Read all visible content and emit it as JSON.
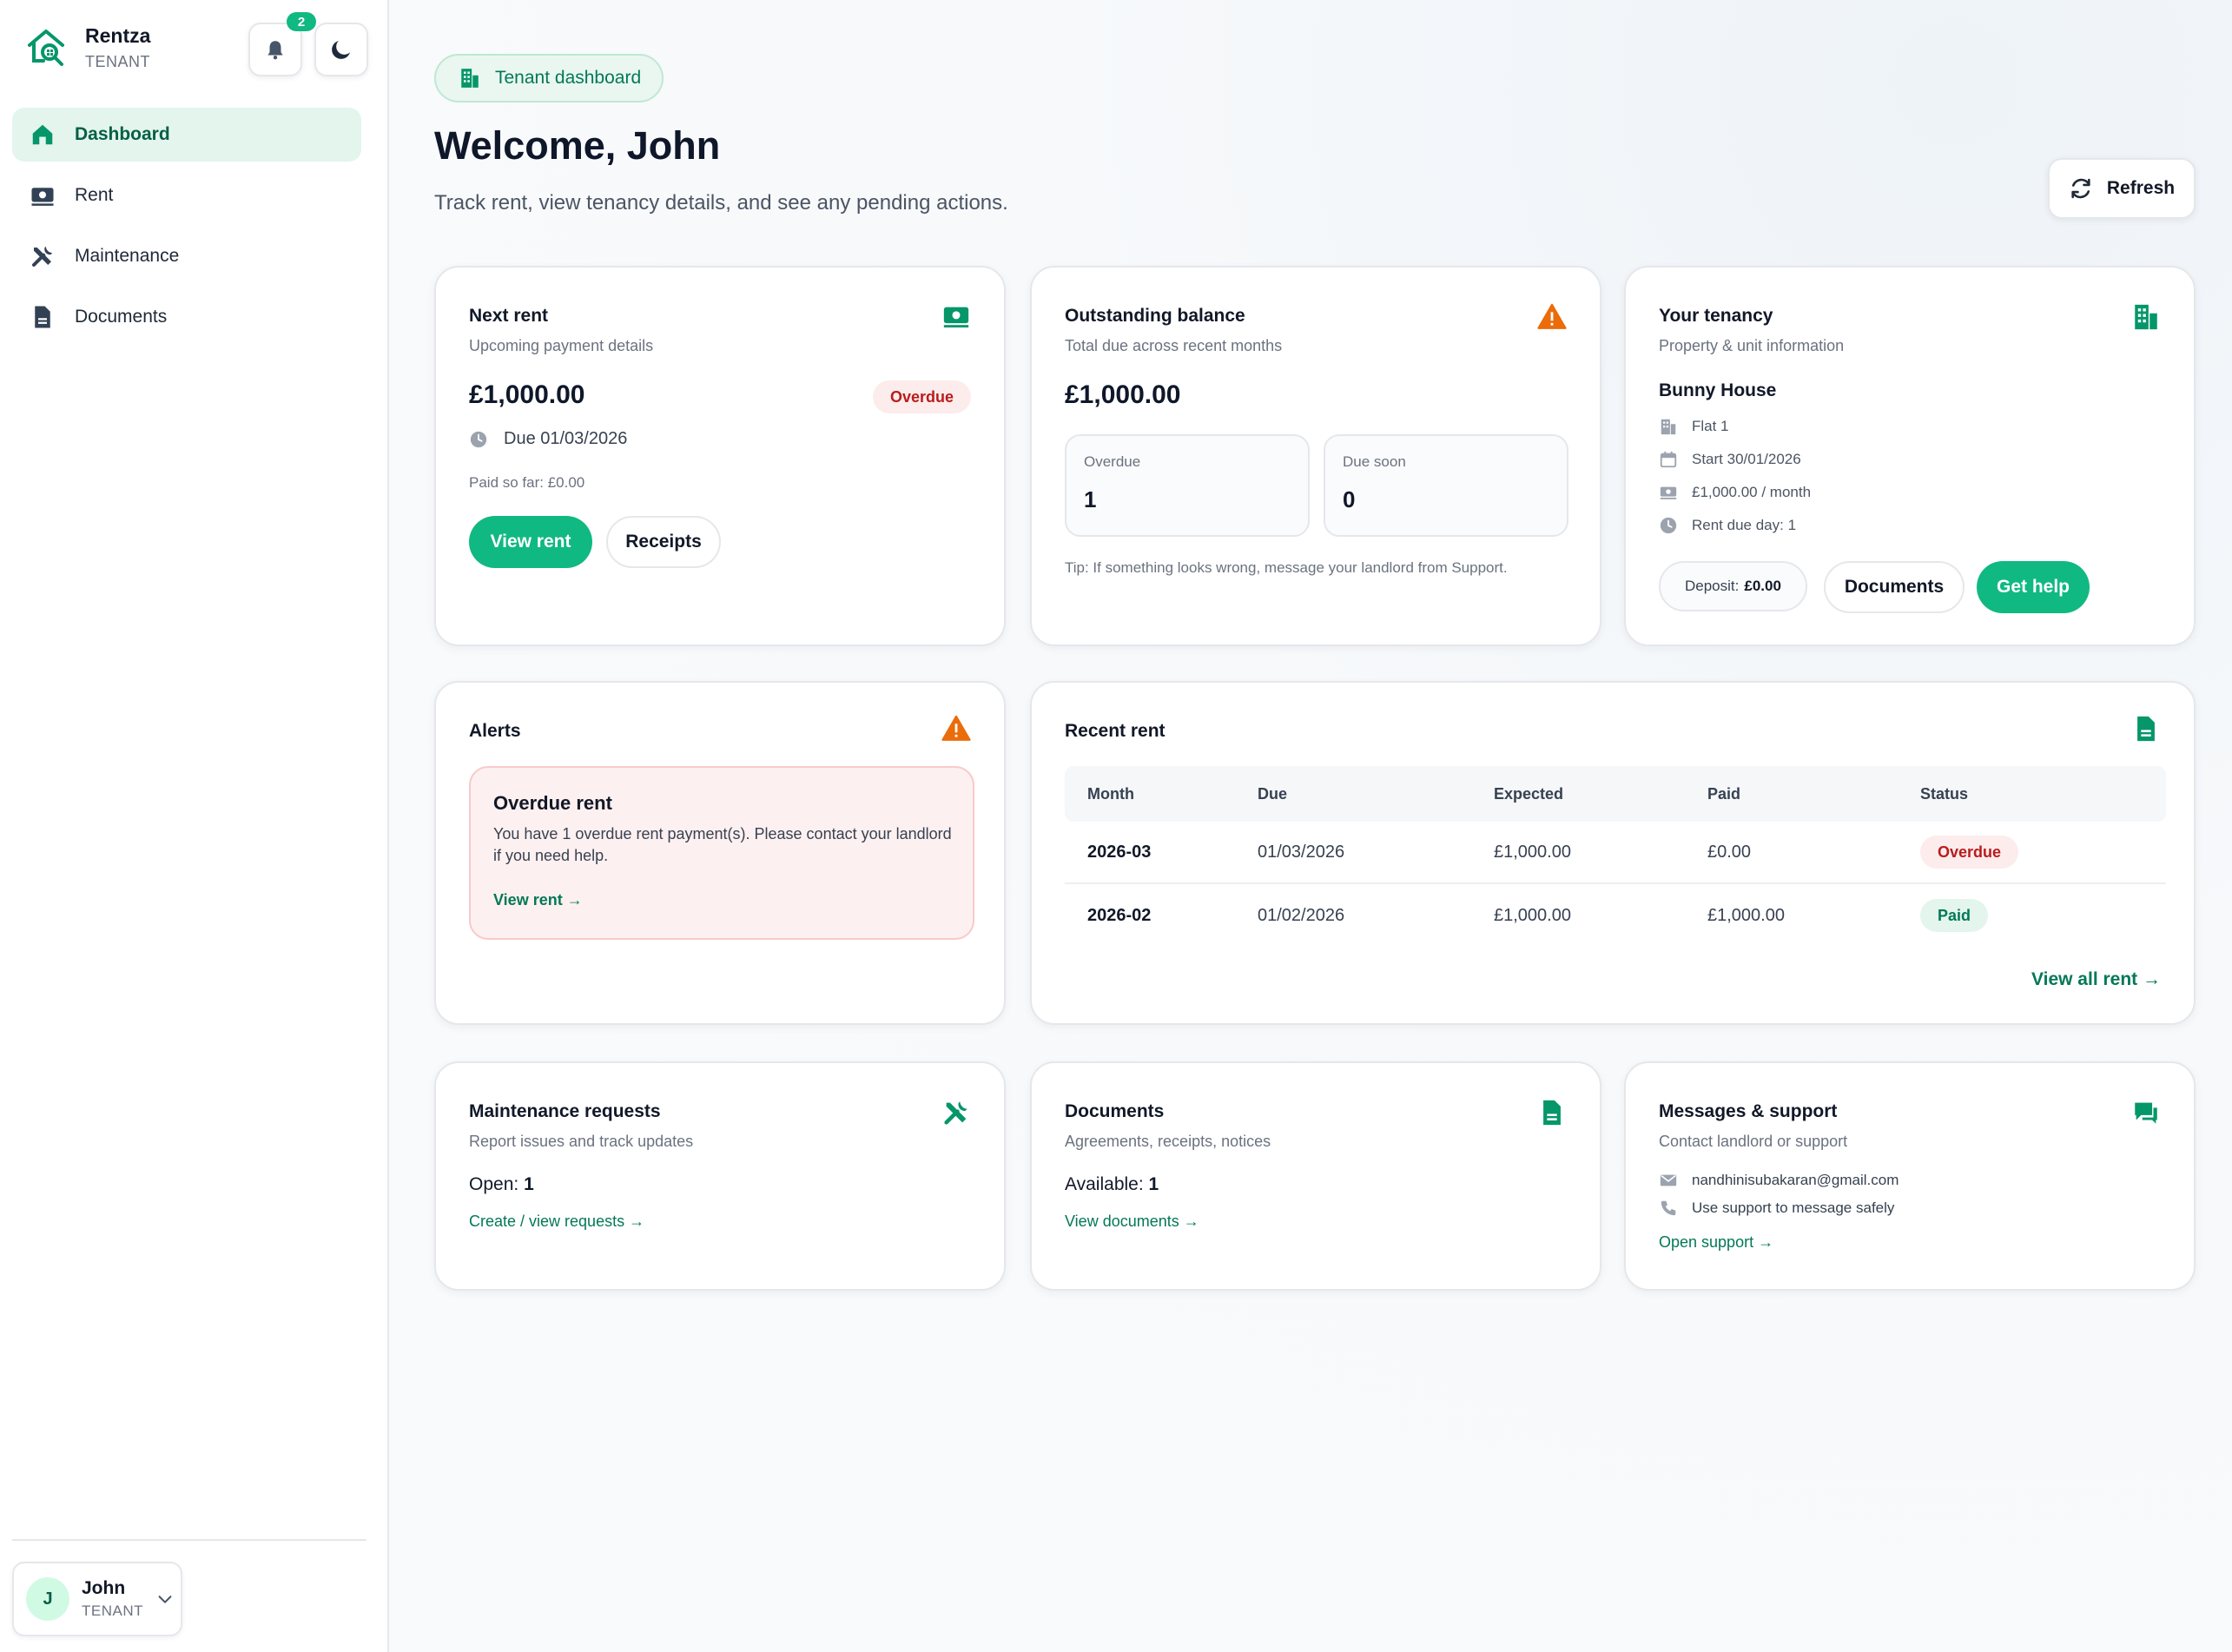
{
  "brand": {
    "name": "Rentza",
    "role": "TENANT"
  },
  "notifications": {
    "count": "2"
  },
  "nav": {
    "items": [
      {
        "label": "Dashboard",
        "icon": "home-icon"
      },
      {
        "label": "Rent",
        "icon": "money-icon"
      },
      {
        "label": "Maintenance",
        "icon": "tools-icon"
      },
      {
        "label": "Documents",
        "icon": "document-icon"
      }
    ]
  },
  "user": {
    "initial": "J",
    "name": "John",
    "role": "TENANT"
  },
  "header": {
    "pill": "Tenant dashboard",
    "title": "Welcome, John",
    "subtitle": "Track rent, view tenancy details, and see any pending actions.",
    "refresh": "Refresh"
  },
  "next_rent": {
    "title": "Next rent",
    "subtitle": "Upcoming payment details",
    "amount": "£1,000.00",
    "status": "Overdue",
    "due": "Due 01/03/2026",
    "paid_so_far": "Paid so far: £0.00",
    "view_rent": "View rent",
    "receipts": "Receipts"
  },
  "balance": {
    "title": "Outstanding balance",
    "subtitle": "Total due across recent months",
    "amount": "£1,000.00",
    "overdue_label": "Overdue",
    "overdue_value": "1",
    "due_soon_label": "Due soon",
    "due_soon_value": "0",
    "tip": "Tip: If something looks wrong, message your landlord from Support."
  },
  "tenancy": {
    "title": "Your tenancy",
    "subtitle": "Property & unit information",
    "property": "Bunny House",
    "unit": "Flat 1",
    "start": "Start 30/01/2026",
    "rent": "£1,000.00 / month",
    "due_day": "Rent due day: 1",
    "deposit_label": "Deposit:",
    "deposit_value": "£0.00",
    "documents": "Documents",
    "get_help": "Get help"
  },
  "alerts": {
    "title": "Alerts",
    "item_title": "Overdue rent",
    "item_text": "You have 1 overdue rent payment(s). Please contact your landlord if you need help.",
    "item_link": "View rent →"
  },
  "recent_rent": {
    "title": "Recent rent",
    "columns": [
      "Month",
      "Due",
      "Expected",
      "Paid",
      "Status"
    ],
    "rows": [
      {
        "month": "2026-03",
        "due": "01/03/2026",
        "expected": "£1,000.00",
        "paid": "£0.00",
        "status": "Overdue"
      },
      {
        "month": "2026-02",
        "due": "01/02/2026",
        "expected": "£1,000.00",
        "paid": "£1,000.00",
        "status": "Paid"
      }
    ],
    "view_all": "View all rent →"
  },
  "maintenance": {
    "title": "Maintenance requests",
    "subtitle": "Report issues and track updates",
    "open_label": "Open:",
    "open_value": "1",
    "link": "Create / view requests →"
  },
  "documents": {
    "title": "Documents",
    "subtitle": "Agreements, receipts, notices",
    "available_label": "Available:",
    "available_value": "1",
    "link": "View documents →"
  },
  "support": {
    "title": "Messages & support",
    "subtitle": "Contact landlord or support",
    "email": "nandhinisubakaran@gmail.com",
    "phone_text": "Use support to message safely",
    "link": "Open support →"
  },
  "colors": {
    "accent": "#10b981",
    "accent_dark": "#047857",
    "warning": "#ea6c0a",
    "danger": "#b91c1c"
  }
}
